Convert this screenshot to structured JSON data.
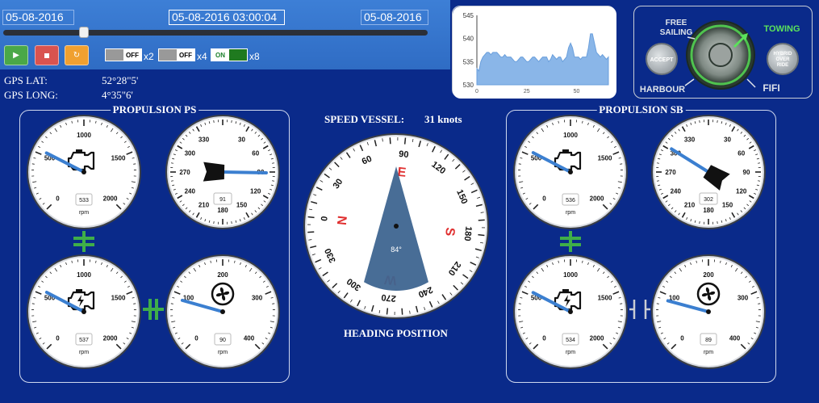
{
  "timeline": {
    "start_date": "05-08-2016",
    "current_datetime": "05-08-2016 03:00:04",
    "end_date": "05-08-2016",
    "progress": 0.19
  },
  "controls": {
    "play_icon": "play-icon",
    "stop_icon": "stop-icon",
    "refresh_icon": "refresh-icon",
    "toggles": [
      {
        "state": "OFF",
        "mult": "x2"
      },
      {
        "state": "OFF",
        "mult": "x4"
      },
      {
        "state": "ON",
        "mult": "x8"
      }
    ]
  },
  "gps": {
    "lat_label": "GPS LAT:",
    "lat_value": "52°28\"5'",
    "long_label": "GPS LONG:",
    "long_value": "4°35\"6'"
  },
  "speed": {
    "label": "SPEED VESSEL:",
    "value": "31 knots"
  },
  "heading": {
    "label": "HEADING POSITION",
    "value": 84,
    "value_label": "84°"
  },
  "mode_selector": {
    "modes": [
      "FREE SAILING",
      "TOWING",
      "HARBOUR",
      "FIFI"
    ],
    "active": "TOWING",
    "accept_label": "ACCEPT",
    "override_label": "HYBRID OVER RIDE"
  },
  "chart_data": {
    "type": "area",
    "y_ticks": [
      "545",
      "540",
      "535",
      "530"
    ],
    "x_ticks": [
      "0",
      "25",
      "50"
    ],
    "ylim": [
      530,
      545
    ],
    "xlim": [
      0,
      66
    ],
    "values": [
      533.5,
      533,
      535,
      536,
      536.5,
      537,
      537,
      536.5,
      537,
      537,
      537,
      536.5,
      536,
      536,
      536.5,
      536,
      536,
      536,
      535.5,
      535,
      535,
      535.5,
      536,
      536,
      535.5,
      535,
      535,
      535.5,
      536,
      536,
      535.5,
      535,
      535.5,
      536,
      536,
      536,
      535,
      535.5,
      536.5,
      536,
      535.5,
      536,
      536,
      535,
      535.5,
      536,
      538,
      539,
      538,
      536,
      536,
      536,
      535.5,
      536,
      536,
      536,
      538,
      541,
      541,
      539,
      537,
      536.5,
      536,
      536.5,
      536,
      535.5,
      536
    ]
  },
  "propulsion_ps": {
    "title": "PROPULSION PS",
    "engine_top": {
      "ticks": [
        "0",
        "500",
        "1000",
        "1500",
        "2000"
      ],
      "value": 533,
      "value_label": "533",
      "unit": "rpm",
      "icon": "engine-icon"
    },
    "steering": {
      "ticks": [
        "330",
        "30",
        "300",
        "60",
        "270",
        "90",
        "240",
        "120",
        "210",
        "150",
        "180"
      ],
      "value": 91,
      "value_label": "91",
      "icon": "thruster-pod-icon"
    },
    "engine_bottom": {
      "ticks": [
        "0",
        "500",
        "1000",
        "1500",
        "2000"
      ],
      "value": 537,
      "value_label": "537",
      "unit": "rpm",
      "icon": "electric-engine-icon"
    },
    "prop": {
      "ticks": [
        "0",
        "100",
        "200",
        "300",
        "400"
      ],
      "value": 90,
      "value_label": "90",
      "unit": "rpm",
      "icon": "fan-icon"
    }
  },
  "propulsion_sb": {
    "title": "PROPULSION SB",
    "engine_top": {
      "ticks": [
        "0",
        "500",
        "1000",
        "1500",
        "2000"
      ],
      "value": 536,
      "value_label": "536",
      "unit": "rpm",
      "icon": "engine-icon"
    },
    "steering": {
      "ticks": [
        "330",
        "30",
        "300",
        "60",
        "270",
        "90",
        "240",
        "120",
        "210",
        "150",
        "180"
      ],
      "value": 302,
      "value_label": "302",
      "icon": "thruster-pod-icon"
    },
    "engine_bottom": {
      "ticks": [
        "0",
        "500",
        "1000",
        "1500",
        "2000"
      ],
      "value": 534,
      "value_label": "534",
      "unit": "rpm",
      "icon": "electric-engine-icon"
    },
    "prop": {
      "ticks": [
        "0",
        "100",
        "200",
        "300",
        "400"
      ],
      "value": 89,
      "value_label": "89",
      "unit": "rpm",
      "icon": "fan-icon"
    }
  },
  "colors": {
    "background": "#0a2a8a",
    "needle": "#3b7fd0",
    "clutch_engaged": "#3fae49",
    "clutch_disengaged": "#c9ccd4",
    "chart_fill": "#8ab6e8",
    "active_mode": "#5be35b"
  }
}
